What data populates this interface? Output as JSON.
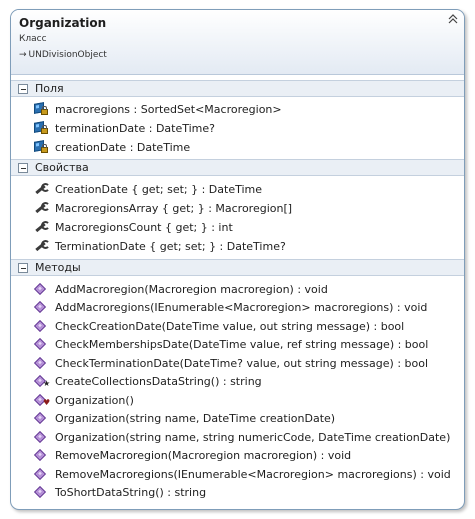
{
  "class": {
    "name": "Organization",
    "kind": "Класс",
    "base": "UNDivisionObject",
    "collapse_glyph": "≈"
  },
  "sections": {
    "fields": {
      "title": "Поля",
      "items": [
        "macroregions : SortedSet<Macroregion>",
        "terminationDate : DateTime?",
        "creationDate : DateTime"
      ]
    },
    "properties": {
      "title": "Свойства",
      "items": [
        "CreationDate { get; set; } : DateTime",
        "MacroregionsArray { get; } : Macroregion[]",
        "MacroregionsCount { get; } : int",
        "TerminationDate { get; set; } : DateTime?"
      ]
    },
    "methods": {
      "title": "Методы",
      "items": [
        "AddMacroregion(Macroregion macroregion) : void",
        "AddMacroregions(IEnumerable<Macroregion> macroregions) : void",
        "CheckCreationDate(DateTime value, out string message) : bool",
        "CheckMembershipsDate(DateTime value, ref string message) : bool",
        "CheckTerminationDate(DateTime? value, out string message) : bool",
        "CreateCollectionsDataString() : string",
        "Organization()",
        "Organization(string name, DateTime creationDate)",
        "Organization(string name, string numericCode, DateTime creationDate)",
        "RemoveMacroregion(Macroregion macroregion) : void",
        "RemoveMacroregions(IEnumerable<Macroregion> macroregions) : void",
        "ToShortDataString() : string"
      ]
    }
  }
}
